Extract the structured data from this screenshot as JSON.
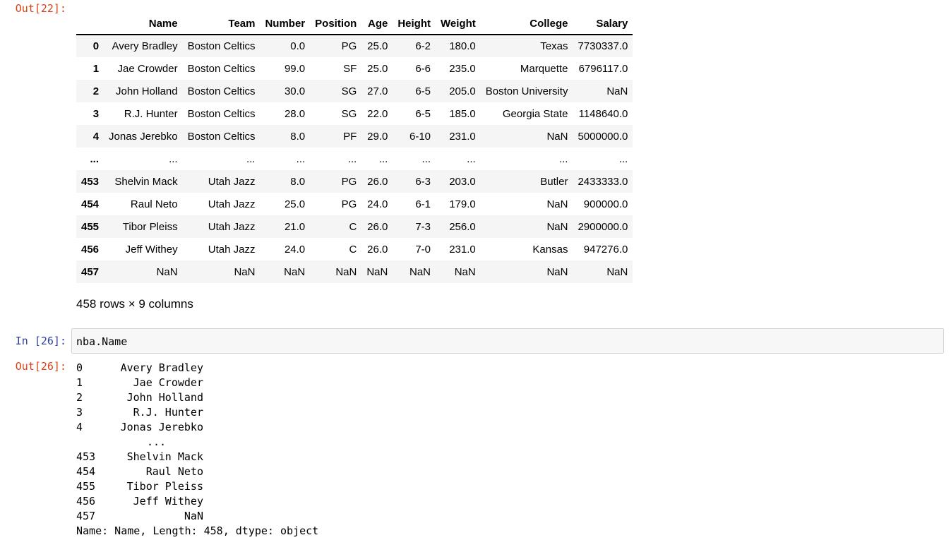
{
  "cell22": {
    "prompt": "Out[22]:",
    "columns": [
      "",
      "Name",
      "Team",
      "Number",
      "Position",
      "Age",
      "Height",
      "Weight",
      "College",
      "Salary"
    ],
    "rows": [
      [
        "0",
        "Avery Bradley",
        "Boston Celtics",
        "0.0",
        "PG",
        "25.0",
        "6-2",
        "180.0",
        "Texas",
        "7730337.0"
      ],
      [
        "1",
        "Jae Crowder",
        "Boston Celtics",
        "99.0",
        "SF",
        "25.0",
        "6-6",
        "235.0",
        "Marquette",
        "6796117.0"
      ],
      [
        "2",
        "John Holland",
        "Boston Celtics",
        "30.0",
        "SG",
        "27.0",
        "6-5",
        "205.0",
        "Boston University",
        "NaN"
      ],
      [
        "3",
        "R.J. Hunter",
        "Boston Celtics",
        "28.0",
        "SG",
        "22.0",
        "6-5",
        "185.0",
        "Georgia State",
        "1148640.0"
      ],
      [
        "4",
        "Jonas Jerebko",
        "Boston Celtics",
        "8.0",
        "PF",
        "29.0",
        "6-10",
        "231.0",
        "NaN",
        "5000000.0"
      ],
      [
        "...",
        "...",
        "...",
        "...",
        "...",
        "...",
        "...",
        "...",
        "...",
        "..."
      ],
      [
        "453",
        "Shelvin Mack",
        "Utah Jazz",
        "8.0",
        "PG",
        "26.0",
        "6-3",
        "203.0",
        "Butler",
        "2433333.0"
      ],
      [
        "454",
        "Raul Neto",
        "Utah Jazz",
        "25.0",
        "PG",
        "24.0",
        "6-1",
        "179.0",
        "NaN",
        "900000.0"
      ],
      [
        "455",
        "Tibor Pleiss",
        "Utah Jazz",
        "21.0",
        "C",
        "26.0",
        "7-3",
        "256.0",
        "NaN",
        "2900000.0"
      ],
      [
        "456",
        "Jeff Withey",
        "Utah Jazz",
        "24.0",
        "C",
        "26.0",
        "7-0",
        "231.0",
        "Kansas",
        "947276.0"
      ],
      [
        "457",
        "NaN",
        "NaN",
        "NaN",
        "NaN",
        "NaN",
        "NaN",
        "NaN",
        "NaN",
        "NaN"
      ]
    ],
    "shape_note": "458 rows × 9 columns"
  },
  "cell26": {
    "in_prompt": "In [26]:",
    "code": "nba.Name",
    "out_prompt": "Out[26]:",
    "series": [
      [
        "0",
        "Avery Bradley"
      ],
      [
        "1",
        "Jae Crowder"
      ],
      [
        "2",
        "John Holland"
      ],
      [
        "3",
        "R.J. Hunter"
      ],
      [
        "4",
        "Jonas Jerebko"
      ],
      [
        "",
        "..."
      ],
      [
        "453",
        "Shelvin Mack"
      ],
      [
        "454",
        "Raul Neto"
      ],
      [
        "455",
        "Tibor Pleiss"
      ],
      [
        "456",
        "Jeff Withey"
      ],
      [
        "457",
        "NaN"
      ]
    ],
    "footer": "Name: Name, Length: 458, dtype: object"
  }
}
